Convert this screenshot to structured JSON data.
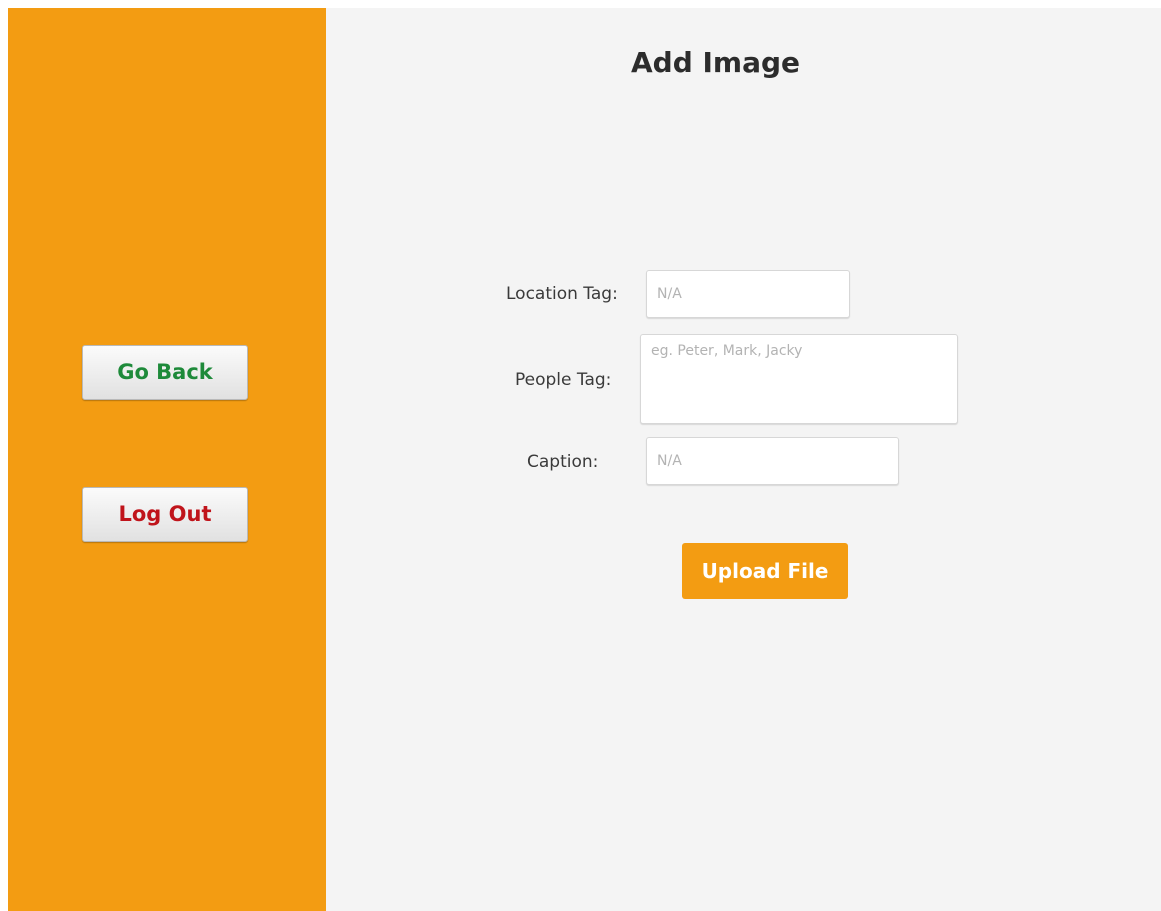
{
  "sidebar": {
    "go_back_label": "Go Back",
    "log_out_label": "Log Out"
  },
  "main": {
    "title": "Add Image",
    "form": {
      "location_tag": {
        "label": "Location Tag:",
        "value": "",
        "placeholder": "N/A"
      },
      "people_tag": {
        "label": "People Tag:",
        "value": "",
        "placeholder": "eg. Peter, Mark, Jacky"
      },
      "caption": {
        "label": "Caption:",
        "value": "",
        "placeholder": "N/A"
      }
    },
    "upload_label": "Upload File"
  },
  "colors": {
    "accent": "#f39c12",
    "main_background": "#f4f4f4",
    "go_back_text": "#1e8a3a",
    "log_out_text": "#c0141b"
  }
}
